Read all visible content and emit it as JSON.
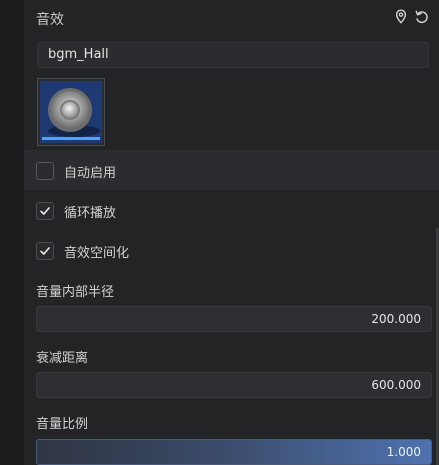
{
  "panel": {
    "title": "音效"
  },
  "icons": {
    "pin": "location-pin-icon",
    "reset": "reset-icon",
    "speaker": "speaker-icon",
    "check": "check-icon"
  },
  "audio": {
    "clip_name": "bgm_Hall"
  },
  "options": {
    "auto_enable": {
      "label": "自动启用",
      "checked": false
    },
    "loop": {
      "label": "循环播放",
      "checked": true
    },
    "spatial": {
      "label": "音效空间化",
      "checked": true
    }
  },
  "fields": {
    "inner_radius": {
      "label": "音量内部半径",
      "value": "200.000"
    },
    "falloff_distance": {
      "label": "衰减距离",
      "value": "600.000"
    },
    "volume_scale": {
      "label": "音量比例",
      "value": "1.000"
    }
  },
  "colors": {
    "background": "#232426",
    "accent": "#4f73b0",
    "thumbnail_bg": "#1f3a73",
    "progress_bar": "#4ea3ff"
  }
}
